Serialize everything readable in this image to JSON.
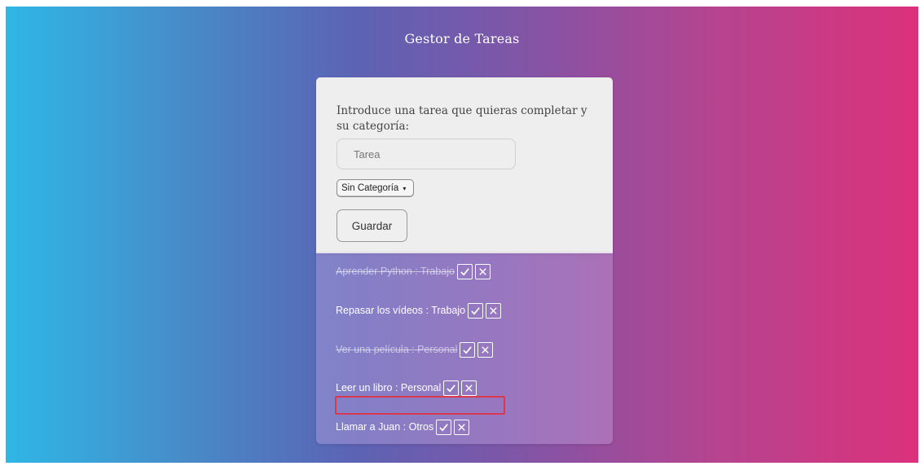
{
  "app": {
    "title": "Gestor de Tareas"
  },
  "form": {
    "prompt": "Introduce una tarea que quieras completar y su categoría:",
    "task_placeholder": "Tarea",
    "category_selected": "Sin Categoría",
    "save_label": "Guardar"
  },
  "tasks": [
    {
      "text": "Aprender Python : Trabajo",
      "done": true
    },
    {
      "text": "Repasar los vídeos : Trabajo",
      "done": false
    },
    {
      "text": "Ver una película : Personal",
      "done": true
    },
    {
      "text": "Leer un libro : Personal",
      "done": false
    },
    {
      "text": "Llamar a Juan : Otros",
      "done": false
    }
  ],
  "icons": {
    "complete": "check-icon",
    "delete": "close-icon"
  },
  "colors": {
    "highlight": "#d9394f",
    "gradient_start": "#2fb7e5",
    "gradient_end": "#dc317b"
  }
}
